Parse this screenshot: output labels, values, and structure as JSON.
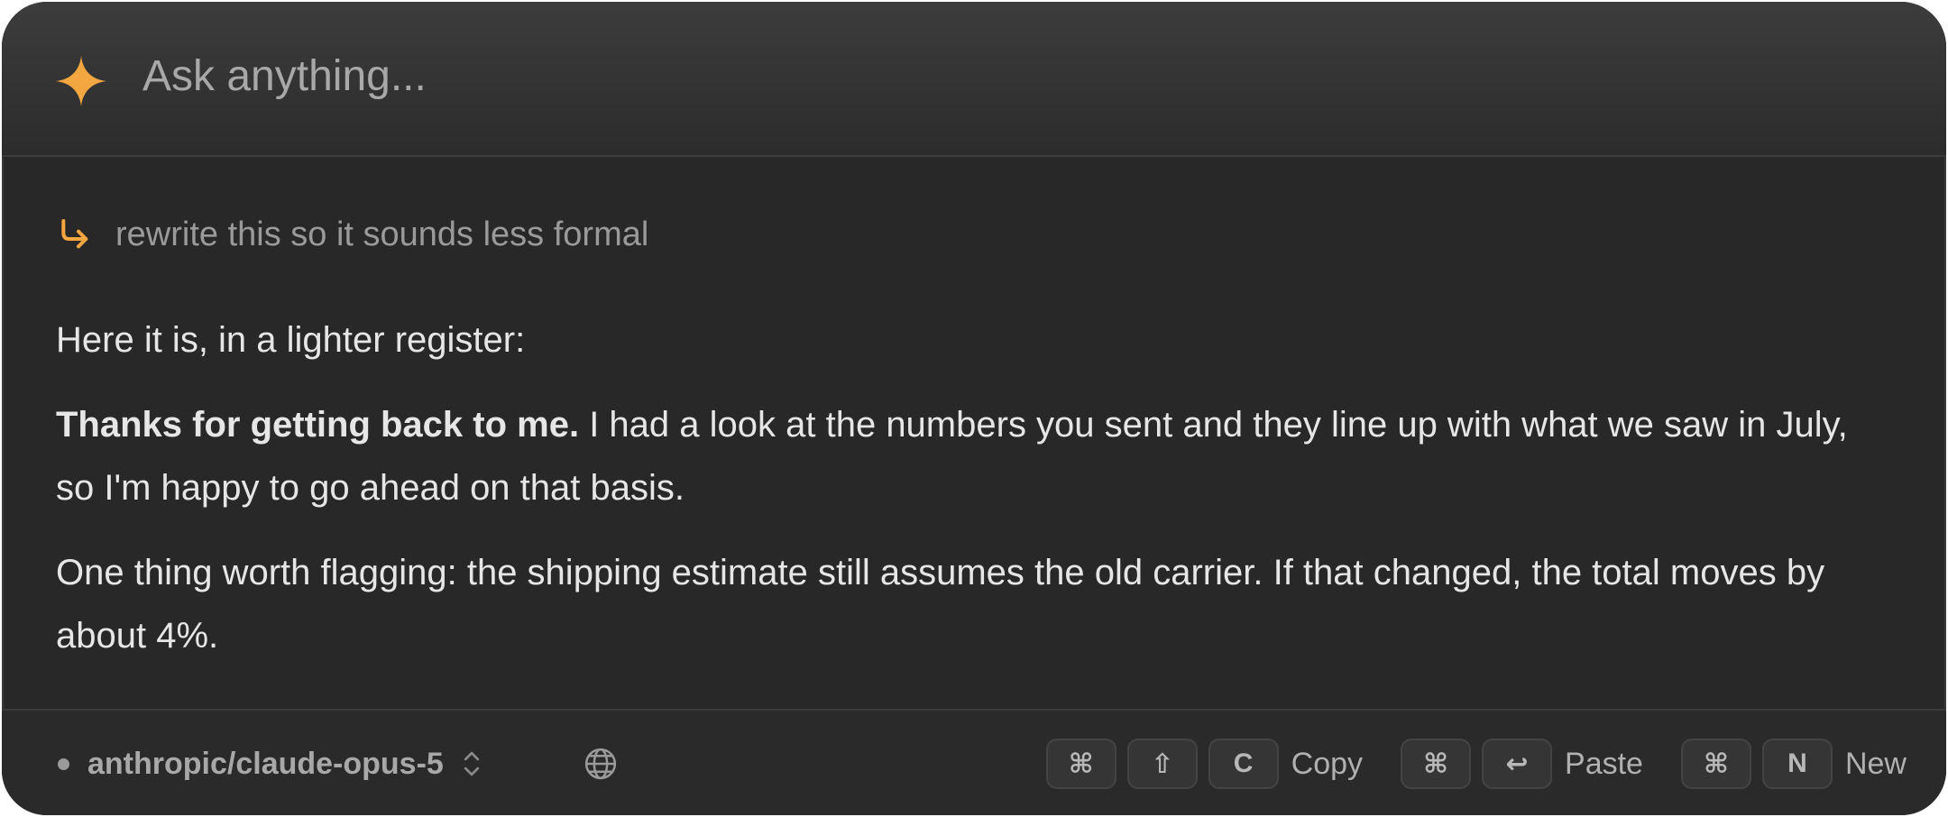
{
  "search": {
    "placeholder": "Ask anything..."
  },
  "query": {
    "text": "rewrite this so it sounds less formal"
  },
  "response": {
    "intro": "Here it is, in a lighter register:",
    "p1_bold": "Thanks for getting back to me.",
    "p1_rest": " I had a look at the numbers you sent and they line up with what we saw in July, so I'm happy to go ahead on that basis.",
    "p2": "One thing worth flagging: the shipping estimate still assumes the old carrier. If that changed, the total moves by about 4%."
  },
  "footer": {
    "model": "anthropic/claude-opus-5",
    "shortcuts": {
      "copy": {
        "keys": [
          "⌘",
          "⇧",
          "C"
        ],
        "label": "Copy"
      },
      "paste": {
        "keys": [
          "⌘",
          "↩"
        ],
        "label": "Paste"
      },
      "new": {
        "keys": [
          "⌘",
          "N"
        ],
        "label": "New"
      }
    }
  },
  "colors": {
    "accent": "#f4a640",
    "panel_bg": "#282828",
    "text_primary": "#e6e6e6",
    "text_muted": "#9a9a9a"
  },
  "icons": {
    "header": "sparkle-icon",
    "query": "reply-arrow-icon",
    "model_selector": "chevron-updown-icon",
    "web": "globe-icon"
  }
}
